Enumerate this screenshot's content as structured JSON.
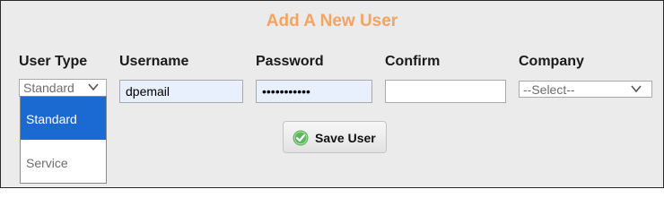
{
  "form": {
    "title": "Add A New User",
    "labels": {
      "user_type": "User Type",
      "username": "Username",
      "password": "Password",
      "confirm": "Confirm",
      "company": "Company"
    },
    "user_type_select": {
      "value": "Standard",
      "options": [
        "Standard",
        "Service"
      ],
      "open": true,
      "highlighted": "Standard"
    },
    "username_value": "dpemail",
    "password_masked": "•••••••••••",
    "confirm_value": "",
    "company_select": {
      "value": "--Select--"
    },
    "save_label": "Save User"
  },
  "colors": {
    "title": "#f4a460",
    "panel_bg": "#ebebeb",
    "autofill_bg": "#e8f0fe",
    "option_highlight": "#1a6ad1",
    "check_icon": "#5cb85c"
  },
  "icons": {
    "save": "check-circle-icon",
    "dropdown": "chevron-down-icon"
  }
}
